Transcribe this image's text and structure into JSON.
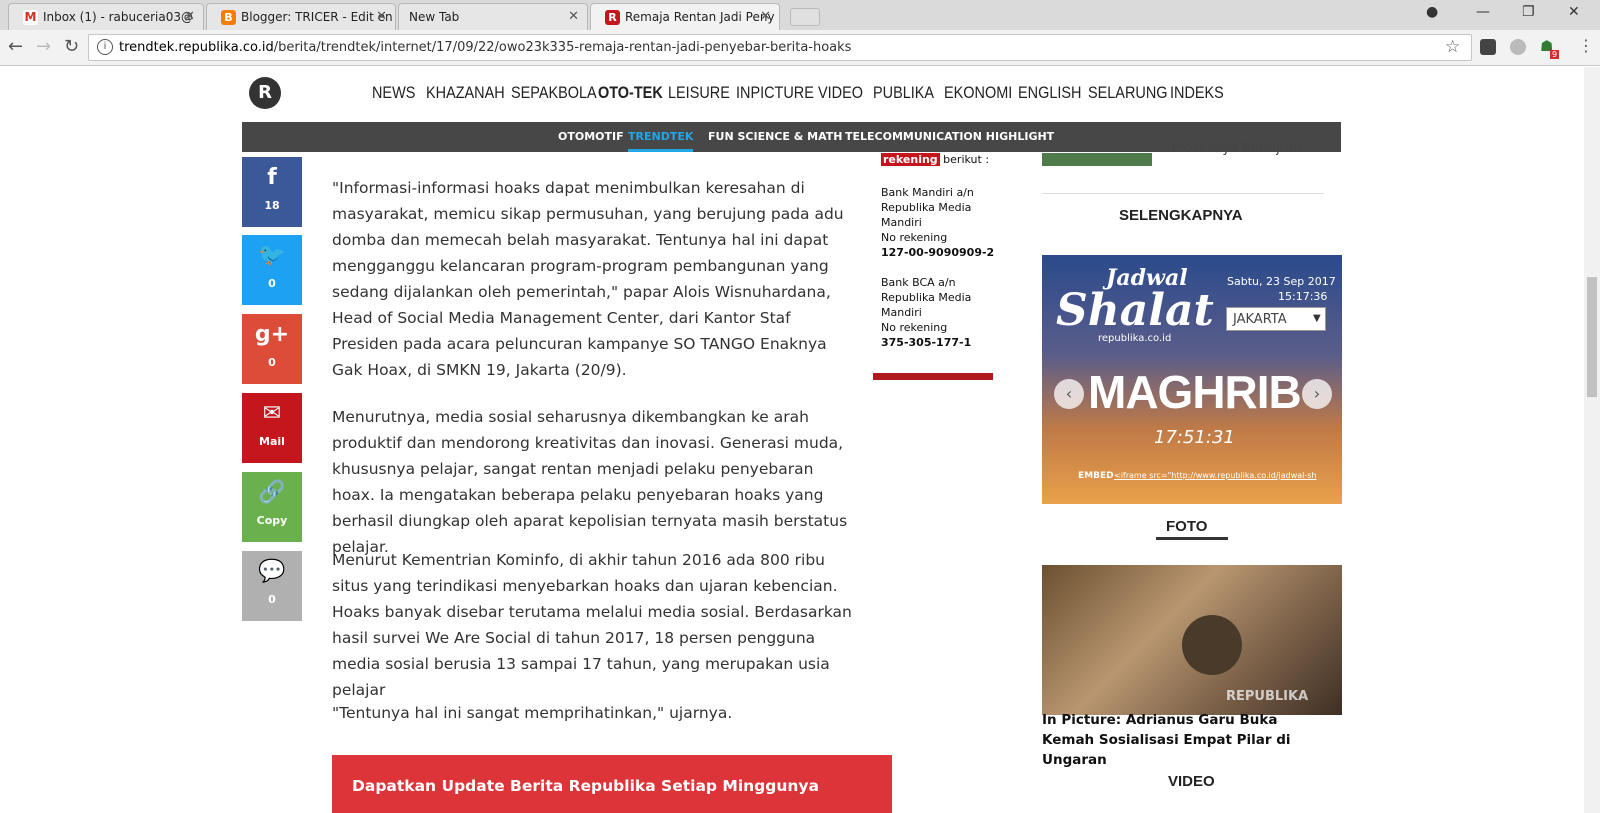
{
  "browser": {
    "tabs": [
      {
        "title": "Inbox (1) - rabuceria03@",
        "favicon_color": "#d93025"
      },
      {
        "title": "Blogger: TRICER - Edit en",
        "favicon_color": "#f57d00"
      },
      {
        "title": "New Tab",
        "favicon_color": ""
      },
      {
        "title": "Remaja Rentan Jadi Peny",
        "favicon_color": "#c4161c"
      }
    ],
    "url_host": "trendtek.republika.co.id",
    "url_path": "/berita/trendtek/internet/17/09/22/owo23k335-remaja-rentan-jadi-penyebar-berita-hoaks",
    "ext_badge": "9"
  },
  "site": {
    "logo": "R",
    "menu": [
      "NEWS",
      "KHAZANAH",
      "SEPAKBOLA",
      "OTO-TEK",
      "LEISURE",
      "INPICTURE",
      "VIDEO",
      "PUBLIKA",
      "EKONOMI",
      "ENGLISH",
      "SELARUNG",
      "INDEKS"
    ],
    "subnav": [
      "OTOMOTIF",
      "TRENDTEK",
      "FUN SCIENCE & MATH",
      "TELECOMMUNICATION HIGHLIGHT"
    ],
    "subnav_active": "TRENDTEK"
  },
  "share": [
    {
      "icon": "f",
      "count": "18",
      "color": "#3b5998"
    },
    {
      "icon": "🐦",
      "count": "0",
      "color": "#1da1f2"
    },
    {
      "icon": "g+",
      "count": "0",
      "color": "#dd4b39"
    },
    {
      "icon": "✉",
      "count": "Mail",
      "color": "#c4161c"
    },
    {
      "icon": "🔗",
      "count": "Copy",
      "color": "#6ab04c"
    },
    {
      "icon": "💬",
      "count": "0",
      "color": "#b0b0b0"
    }
  ],
  "article": {
    "p1": "\"Informasi-informasi hoaks dapat menimbulkan keresahan di masyarakat, memicu sikap permusuhan, yang berujung pada adu domba dan memecah belah masyarakat. Tentunya hal ini dapat mengganggu kelancaran program-program pembangunan yang sedang dijalankan oleh pemerintah,\" papar Alois Wisnuhardana, Head of Social Media Management Center, dari Kantor Staf Presiden pada acara peluncuran kampanye SO TANGO Enaknya Gak Hoax, di SMKN 19, Jakarta (20/9).",
    "p2": "Menurutnya, media sosial seharusnya dikembangkan ke arah produktif dan mendorong kreativitas dan inovasi. Generasi muda, khususnya pelajar, sangat rentan menjadi pelaku penyebaran hoax. Ia mengatakan beberapa pelaku penyebaran hoaks yang berhasil diungkap oleh aparat kepolisian ternyata masih berstatus pelajar.",
    "p3": "Menurut Kementrian Kominfo, di akhir tahun 2016 ada 800 ribu situs yang terindikasi menyebarkan hoaks dan ujaran kebencian. Hoaks banyak disebar terutama melalui media sosial. Berdasarkan hasil survei We Are Social di tahun 2017, 18 persen pengguna media sosial berusia 13 sampai 17 tahun, yang merupakan usia pelajar",
    "p4": "\"Tentunya hal ini sangat memprihatinkan,\" ujarnya.",
    "promo": "Dapatkan Update Berita Republika Setiap Minggunya"
  },
  "donation": {
    "tag": "rekening",
    "tag_suffix": " berikut :",
    "bank1": "Bank Mandiri a/n Republika Media Mandiri",
    "norek_label": "No rekening",
    "bank1_no": "127-00-9090909-2",
    "bank2": "Bank BCA a/n Republika Media Mandiri",
    "bank2_no": "375-305-177-1"
  },
  "sidebar": {
    "partial_text": "Prosesnya Berhijrah",
    "selengkapnya": "SELENGKAPNYA",
    "jadwal": {
      "title1": "Jadwal",
      "title2": "Shalat",
      "site": "republika.co.id",
      "date": "Sabtu, 23 Sep 2017",
      "time": "15:17:36",
      "city": "JAKARTA",
      "prayer": "MAGHRIB",
      "prayer_time": "17:51:31",
      "embed_label": "EMBED",
      "embed_code": "<iframe src=\"http://www.republika.co.id/jadwal-sh"
    },
    "foto_header": "FOTO",
    "foto_watermark": "REPUBLIKA",
    "foto_caption": "In Picture: Adrianus Garu Buka Kemah Sosialisasi Empat Pilar di Ungaran",
    "video_header": "VIDEO"
  }
}
